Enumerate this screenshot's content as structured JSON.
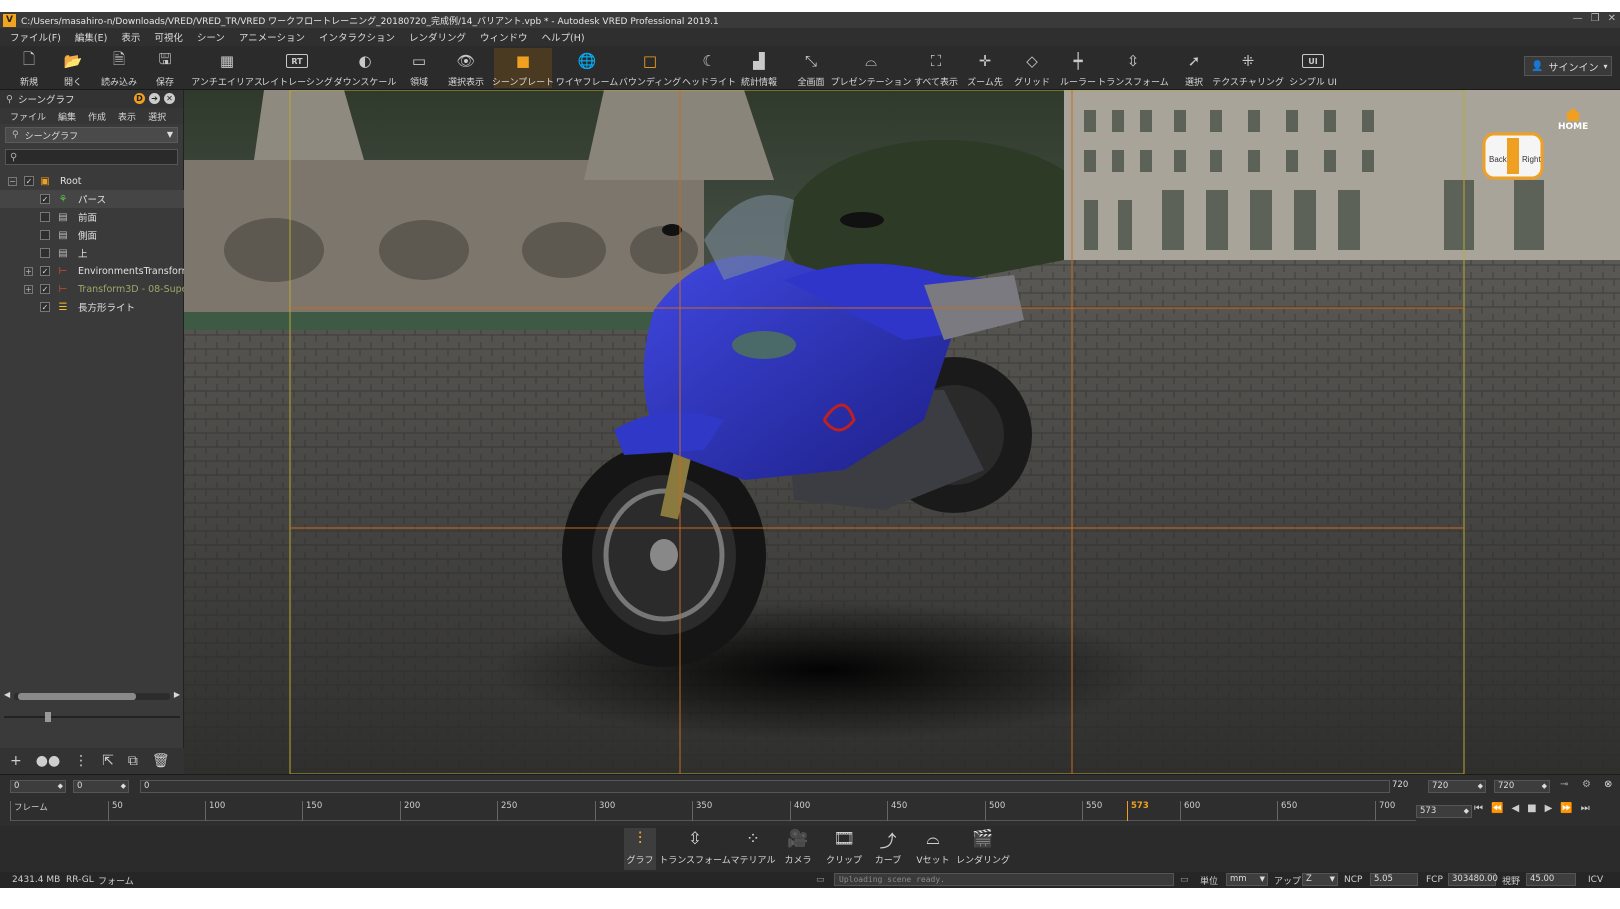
{
  "window": {
    "title": "C:/Users/masahiro-n/Downloads/VRED/VRED_TR/VRED ワークフロートレーニング_20180720_完成例/14_バリアント.vpb * - Autodesk VRED Professional 2019.1",
    "app_icon": "V"
  },
  "menubar": [
    "ファイル(F)",
    "編集(E)",
    "表示",
    "可視化",
    "シーン",
    "アニメーション",
    "インタラクション",
    "レンダリング",
    "ウィンドウ",
    "ヘルプ(H)"
  ],
  "toolbar": {
    "buttons": [
      {
        "label": "新規",
        "icon": "new-file-icon"
      },
      {
        "label": "開く",
        "icon": "open-folder-icon"
      },
      {
        "label": "読み込み",
        "icon": "import-icon"
      },
      {
        "label": "保存",
        "icon": "save-icon"
      },
      {
        "label": "アンチエイリアス",
        "icon": "antialias-icon"
      },
      {
        "label": "レイトレーシング",
        "icon": "raytracing-icon",
        "glyph": "RT"
      },
      {
        "label": "ダウンスケール",
        "icon": "downscale-icon"
      },
      {
        "label": "領域",
        "icon": "region-icon"
      },
      {
        "label": "選択表示",
        "icon": "eye-icon"
      },
      {
        "label": "シーンプレート",
        "icon": "sceneplate-icon"
      },
      {
        "label": "ワイヤフレーム",
        "icon": "wireframe-icon"
      },
      {
        "label": "バウンディング",
        "icon": "bounding-icon"
      },
      {
        "label": "ヘッドライト",
        "icon": "headlight-icon"
      },
      {
        "label": "統計情報",
        "icon": "statistics-icon"
      },
      {
        "label": "全画面",
        "icon": "fullscreen-icon"
      },
      {
        "label": "プレゼンテーション",
        "icon": "presentation-icon"
      },
      {
        "label": "すべて表示",
        "icon": "show-all-icon"
      },
      {
        "label": "ズーム先",
        "icon": "zoom-to-icon"
      },
      {
        "label": "グリッド",
        "icon": "grid-icon"
      },
      {
        "label": "ルーラー",
        "icon": "ruler-icon"
      },
      {
        "label": "トランスフォーム",
        "icon": "transform-icon"
      },
      {
        "label": "選択",
        "icon": "select-icon"
      },
      {
        "label": "テクスチャリング",
        "icon": "texturing-icon"
      },
      {
        "label": "シンプル UI",
        "icon": "simple-ui-icon",
        "glyph": "UI"
      }
    ],
    "signin": "サインイン"
  },
  "scenegraph": {
    "title": "シーングラフ",
    "menu": [
      "ファイル",
      "編集",
      "作成",
      "表示",
      "選択"
    ],
    "dropdown": "シーングラフ",
    "search_placeholder": "",
    "nodes": [
      {
        "label": "Root",
        "level": 0,
        "checked": true,
        "expandable": true,
        "expanded": true
      },
      {
        "label": "パース",
        "level": 1,
        "checked": true,
        "expandable": false
      },
      {
        "label": "前面",
        "level": 1,
        "checked": false,
        "expandable": false
      },
      {
        "label": "側面",
        "level": 1,
        "checked": false,
        "expandable": false
      },
      {
        "label": "上",
        "level": 1,
        "checked": false,
        "expandable": false
      },
      {
        "label": "EnvironmentsTransform",
        "level": 1,
        "checked": true,
        "expandable": true,
        "expanded": false
      },
      {
        "label": "Transform3D - 08-Supe",
        "level": 1,
        "checked": true,
        "expandable": true,
        "expanded": false,
        "dim": true
      },
      {
        "label": "長方形ライト",
        "level": 1,
        "checked": true,
        "expandable": false
      }
    ]
  },
  "navcube": {
    "home_label": "HOME",
    "left_face": "Back",
    "right_face": "Right"
  },
  "timeline": {
    "start_frame": "0",
    "in_frame": "0",
    "cursor_frame": "0",
    "end_label": "720",
    "end_frame_a": "720",
    "end_frame_b": "720",
    "ruler_label": "フレーム",
    "ticks": [
      "50",
      "100",
      "150",
      "200",
      "250",
      "300",
      "350",
      "400",
      "450",
      "500",
      "550",
      "573",
      "600",
      "650",
      "700"
    ],
    "current_frame": "573",
    "current_frame_field": "573"
  },
  "modules": [
    {
      "label": "グラフ",
      "icon": "graph-icon",
      "active": true
    },
    {
      "label": "トランスフォーム",
      "icon": "transform-icon"
    },
    {
      "label": "マテリアル",
      "icon": "material-icon"
    },
    {
      "label": "カメラ",
      "icon": "camera-icon"
    },
    {
      "label": "クリップ",
      "icon": "clip-icon"
    },
    {
      "label": "カーブ",
      "icon": "curve-icon"
    },
    {
      "label": "Vセット",
      "icon": "vset-icon"
    },
    {
      "label": "レンダリング",
      "icon": "rendering-icon"
    }
  ],
  "status": {
    "memory": "2431.4 MB",
    "renderer": "RR-GL",
    "mode": "フォーム",
    "message": "Uploading scene ready.",
    "unit_label": "単位",
    "unit_value": "mm",
    "up_label": "アップ",
    "up_value": "Z",
    "ncp_label": "NCP",
    "ncp_value": "5.05",
    "fcp_label": "FCP",
    "fcp_value": "303480.00",
    "fov_label": "視野",
    "fov_value": "45.00",
    "icv_label": "ICV"
  },
  "colors": {
    "accent": "#f0a020",
    "motorcycle_body": "#2a2fbf",
    "viewport_guides_yellow": "#b8a830",
    "viewport_guides_orange": "#c86a20"
  }
}
